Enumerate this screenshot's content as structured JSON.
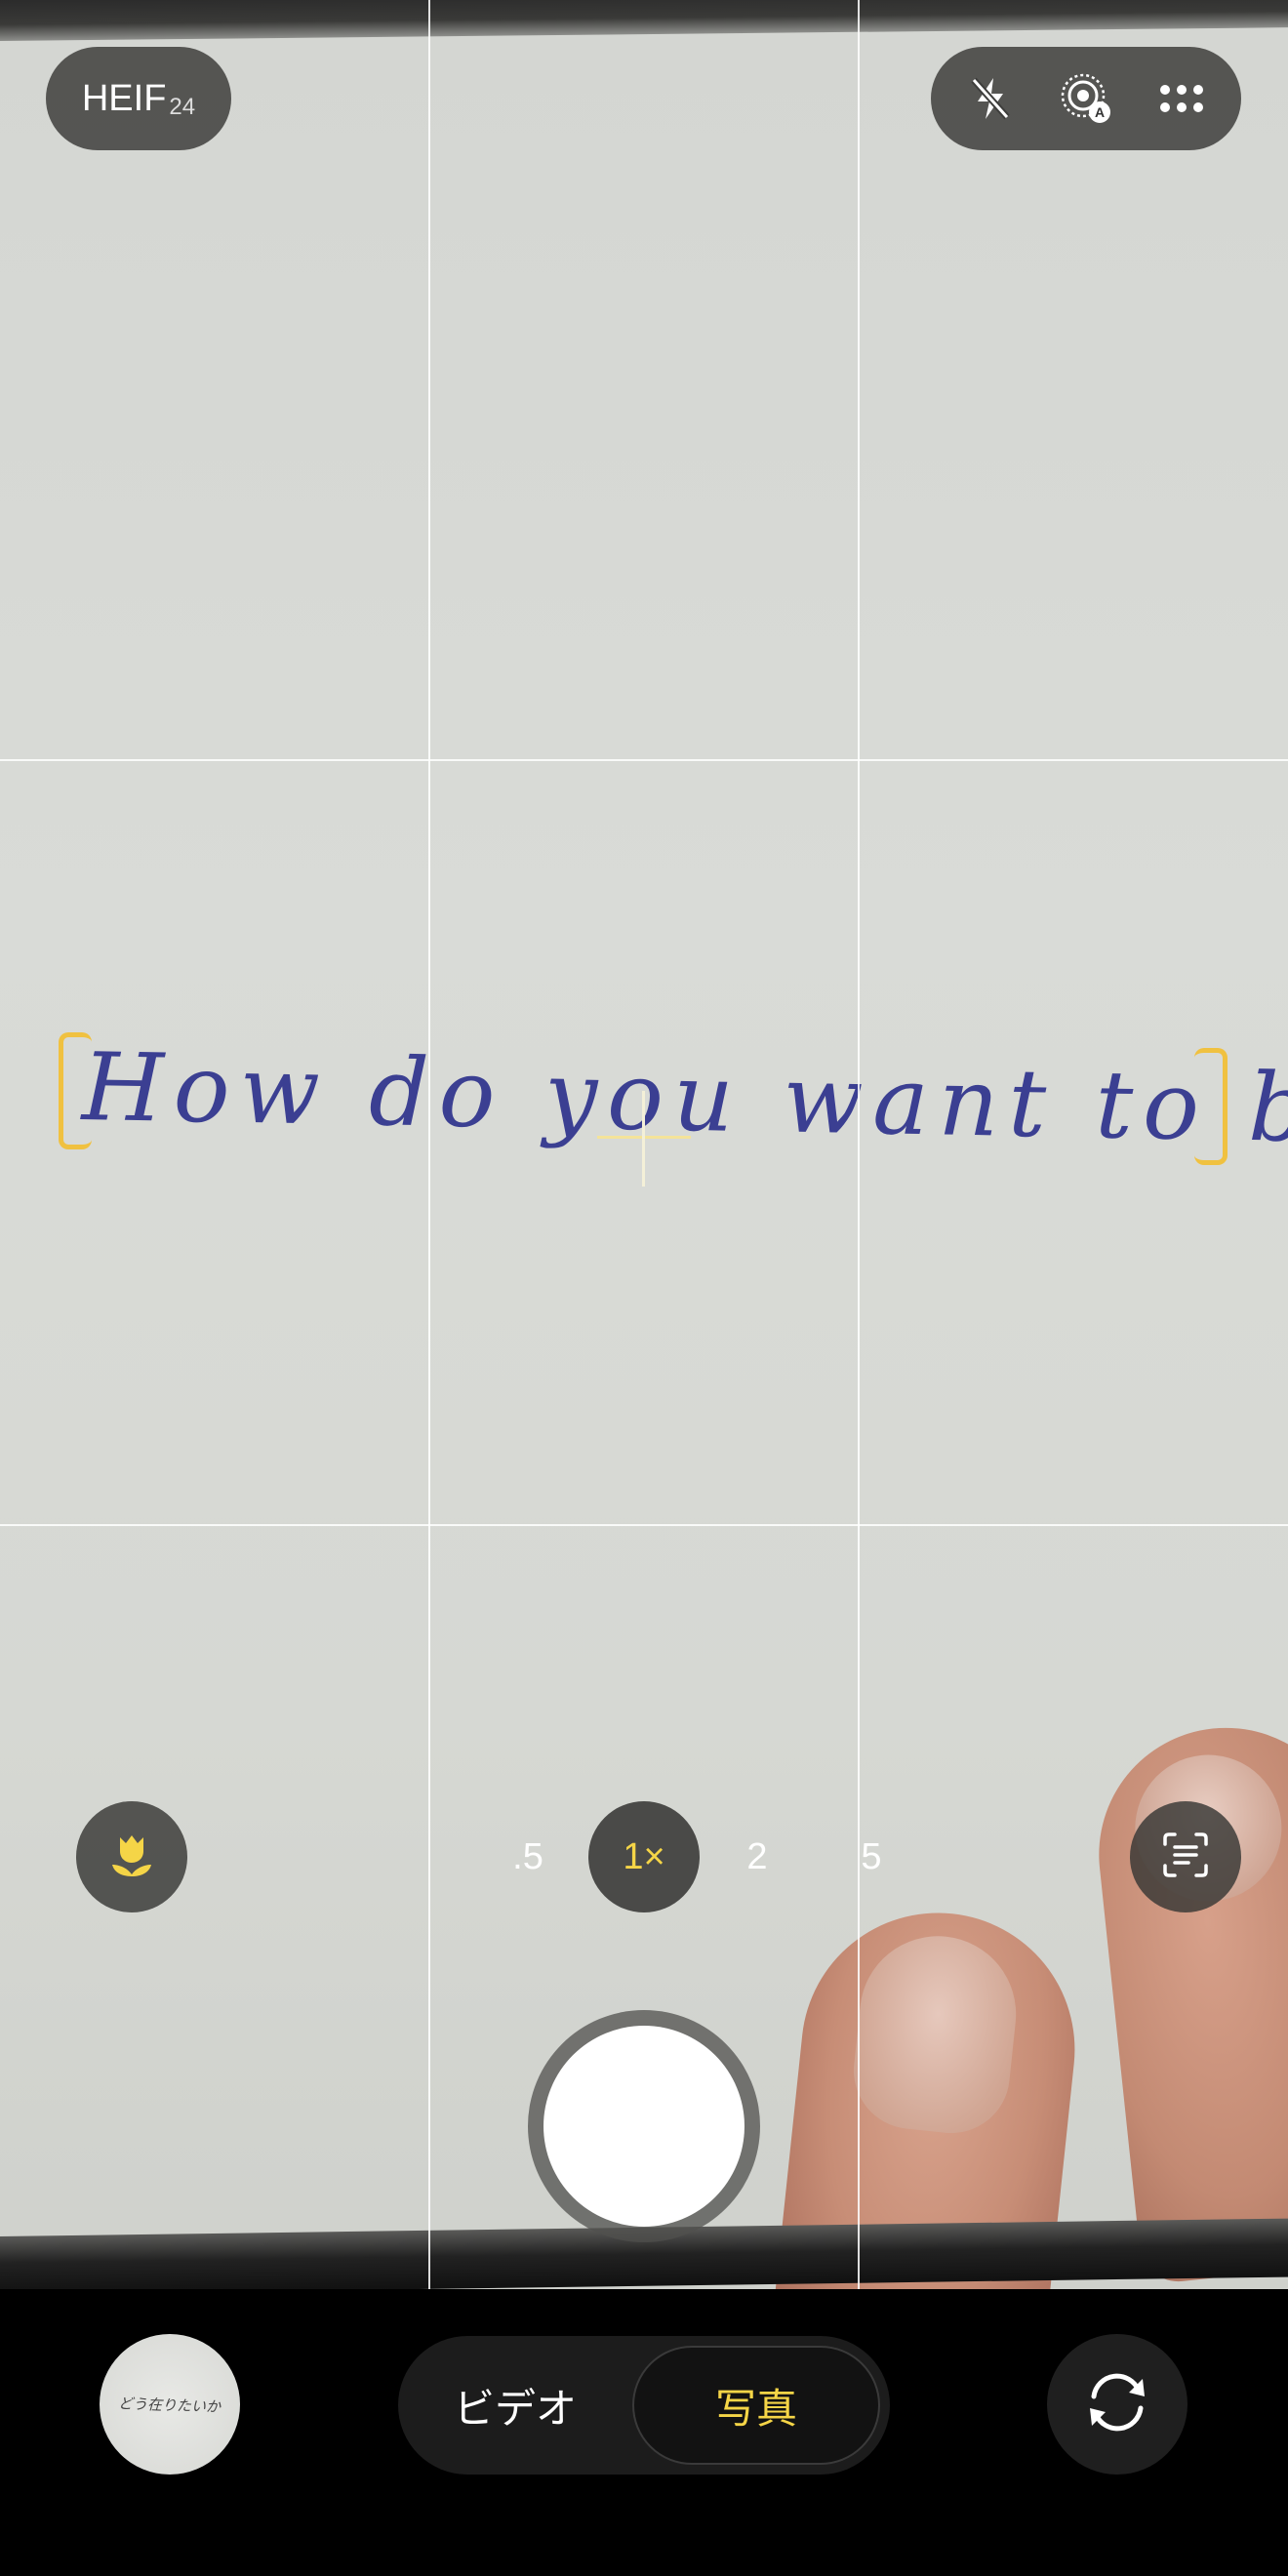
{
  "viewfinder": {
    "handwritten_text": "How do you want to be?",
    "grid": "3x3",
    "focus": "crosshair"
  },
  "top_bar": {
    "format_label": "HEIF",
    "format_sub": "24",
    "controls": [
      {
        "icon": "flash-off-icon"
      },
      {
        "icon": "live-photo-auto-icon"
      },
      {
        "icon": "more-grid-icon"
      }
    ]
  },
  "tools": {
    "macro_icon": "tulip-icon",
    "scan_icon": "text-scan-icon"
  },
  "zoom": {
    "levels": [
      ".5",
      "1×",
      "2",
      "5"
    ],
    "selected": "1×"
  },
  "bottom": {
    "thumbnail_text": "どう在りたいか",
    "modes": {
      "video": "ビデオ",
      "photo": "写真",
      "selected": "写真"
    },
    "flip_icon": "camera-flip-icon"
  },
  "colors": {
    "accent": "#f5d547",
    "focus_bracket": "#f0c140",
    "ink": "#3b3f92"
  }
}
